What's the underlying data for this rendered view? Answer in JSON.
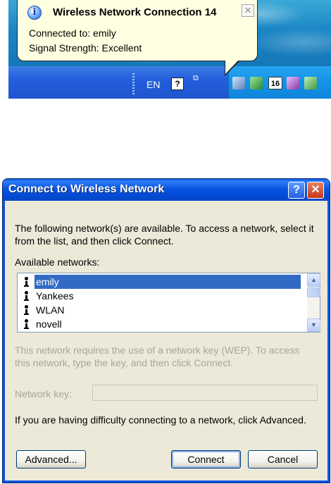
{
  "balloon": {
    "title": "Wireless Network Connection 14",
    "connected_line": "Connected to: emily",
    "signal_line": "Signal Strength: Excellent",
    "close_glyph": "✕",
    "icon": "info-icon"
  },
  "taskbar": {
    "language": "EN",
    "help_glyph": "?",
    "restore_glyph": "⧉",
    "calendar_day": "16",
    "tray_icons": [
      "network-icon",
      "security-icon",
      "calendar-icon",
      "device-icon",
      "update-icon"
    ]
  },
  "dialog": {
    "title": "Connect to Wireless Network",
    "help_glyph": "?",
    "close_glyph": "✕",
    "intro": "The following network(s) are available. To access a network, select it from the list, and then click Connect.",
    "available_label": "Available networks:",
    "networks": [
      "emily",
      "Yankees",
      "WLAN",
      "novell"
    ],
    "selected_network": "emily",
    "wep_note": "This network requires the use of a network key (WEP). To access this network, type the key, and then click Connect.",
    "network_key_label": "Network key:",
    "network_key_value": "",
    "advanced_hint": "If you are having difficulty connecting to a network, click Advanced.",
    "buttons": {
      "advanced": "Advanced...",
      "connect": "Connect",
      "cancel": "Cancel"
    }
  },
  "colors": {
    "titlebar": "#0856e0",
    "dialog_bg": "#ece9d8",
    "selection": "#316ac5",
    "balloon_bg": "#ffffe1",
    "disabled_text": "#a7a69b"
  }
}
